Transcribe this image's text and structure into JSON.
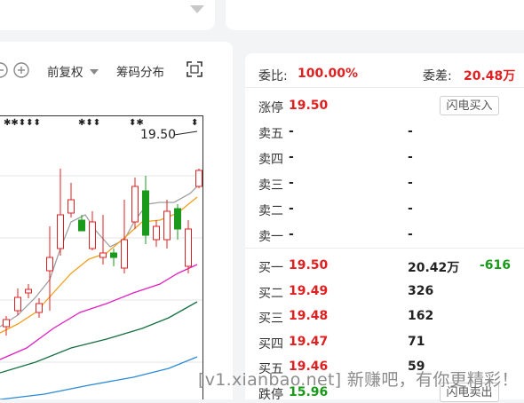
{
  "toolbar": {
    "fuquan_label": "前复权",
    "chip_label": "筹码分布"
  },
  "chart": {
    "stars_text_1": "✱✱⬍⬍⬍",
    "stars_text_2": "✱⬍⬍",
    "stars_text_3": "⬍✱",
    "stars_text_4": "⬍",
    "high_label": "19.50"
  },
  "orderbook": {
    "weibi_label": "委比:",
    "weibi_value": "100.00%",
    "weicha_label": "委差:",
    "weicha_value": "20.48万",
    "limit_up_label": "涨停",
    "limit_up_value": "19.50",
    "flash_buy": "闪电买入",
    "sells": [
      {
        "label": "卖五",
        "price": "-",
        "vol": "-"
      },
      {
        "label": "卖四",
        "price": "-",
        "vol": "-"
      },
      {
        "label": "卖三",
        "price": "-",
        "vol": "-"
      },
      {
        "label": "卖二",
        "price": "-",
        "vol": "-"
      },
      {
        "label": "卖一",
        "price": "-",
        "vol": "-"
      }
    ],
    "buys": [
      {
        "label": "买一",
        "price": "19.50",
        "vol": "20.42万",
        "chg": "-616"
      },
      {
        "label": "买二",
        "price": "19.49",
        "vol": "326",
        "chg": ""
      },
      {
        "label": "买三",
        "price": "19.48",
        "vol": "162",
        "chg": ""
      },
      {
        "label": "买四",
        "price": "19.47",
        "vol": "71",
        "chg": ""
      },
      {
        "label": "买五",
        "price": "19.46",
        "vol": "59",
        "chg": ""
      }
    ],
    "limit_down_label": "跌停",
    "limit_down_value": "15.96",
    "flash_sell": "闪电卖出"
  },
  "watermark": "[v1.xianbao.net] 新赚吧，有你更精彩！",
  "colors": {
    "up": "#e02020",
    "down": "#1a9a1a",
    "ma5": "#a0a0a0",
    "ma10": "#f0a020",
    "ma20": "#e020c0",
    "ma30": "#157040",
    "ma60": "#2a8ad8"
  }
}
